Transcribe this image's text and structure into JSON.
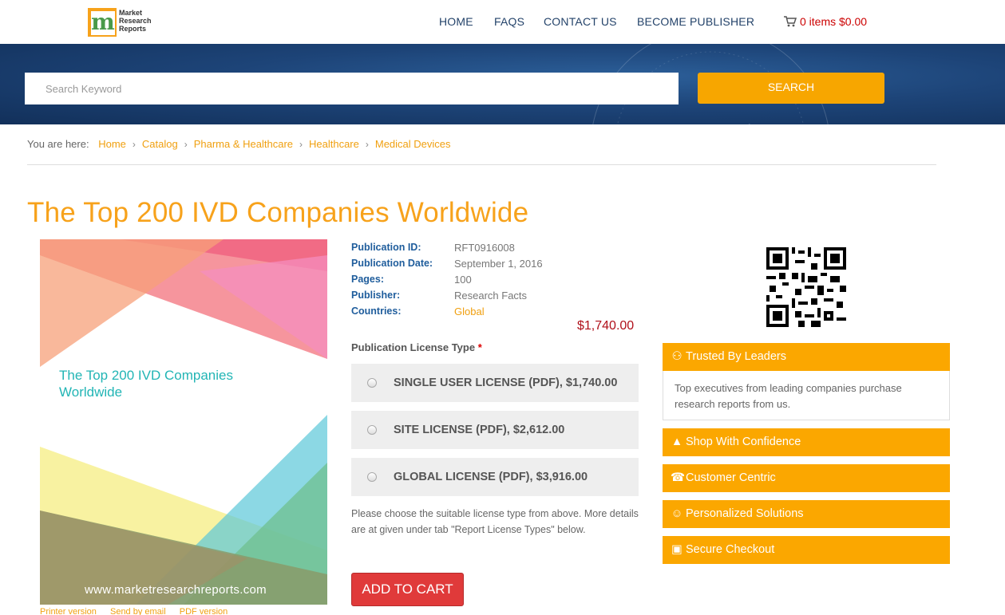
{
  "logo": {
    "line1": "Market",
    "line2": "Research",
    "line3": "Reports",
    "mark": "m"
  },
  "nav": {
    "items": [
      "HOME",
      "FAQS",
      "CONTACT US",
      "BECOME PUBLISHER"
    ]
  },
  "cart": {
    "label": "0 items $0.00",
    "icon": "shopping-cart-icon"
  },
  "search": {
    "placeholder": "Search Keyword",
    "button": "SEARCH"
  },
  "breadcrumb": {
    "prefix": "You are here:",
    "items": [
      "Home",
      "Catalog",
      "Pharma & Healthcare",
      "Healthcare",
      "Medical Devices"
    ]
  },
  "page_title": "The Top 200 IVD Companies Worldwide",
  "cover": {
    "title": "The Top 200 IVD Companies Worldwide",
    "url": "www.marketresearchreports.com"
  },
  "doc_links": [
    "Printer version",
    "Send by email",
    "PDF version"
  ],
  "details": [
    {
      "label": "Publication ID:",
      "value": "RFT0916008"
    },
    {
      "label": "Publication Date:",
      "value": "September 1, 2016"
    },
    {
      "label": "Pages:",
      "value": "100"
    },
    {
      "label": "Publisher:",
      "value": "Research Facts"
    },
    {
      "label": "Countries:",
      "value": "Global"
    }
  ],
  "price": "$1,740.00",
  "license": {
    "heading": "Publication License Type",
    "required_mark": "*",
    "options": [
      "SINGLE USER LICENSE (PDF), $1,740.00",
      "SITE LICENSE (PDF), $2,612.00",
      "GLOBAL LICENSE (PDF), $3,916.00"
    ],
    "note": "Please choose the suitable license type from above. More details are at given under tab \"Report License Types\" below."
  },
  "add_to_cart": "ADD TO CART",
  "sidebar": {
    "trusted": {
      "title": "Trusted By Leaders",
      "body": "Top executives from leading companies purchase research reports from us."
    },
    "items": [
      "Shop With Confidence",
      "Customer Centric",
      "Personalized Solutions",
      "Secure Checkout"
    ]
  },
  "colors": {
    "accent": "#f7a21b",
    "nav": "#24436a",
    "banner": "#1d4478",
    "label_blue": "#1f5d9c",
    "price_red": "#b0101a",
    "cart_red": "#e03a3a"
  }
}
